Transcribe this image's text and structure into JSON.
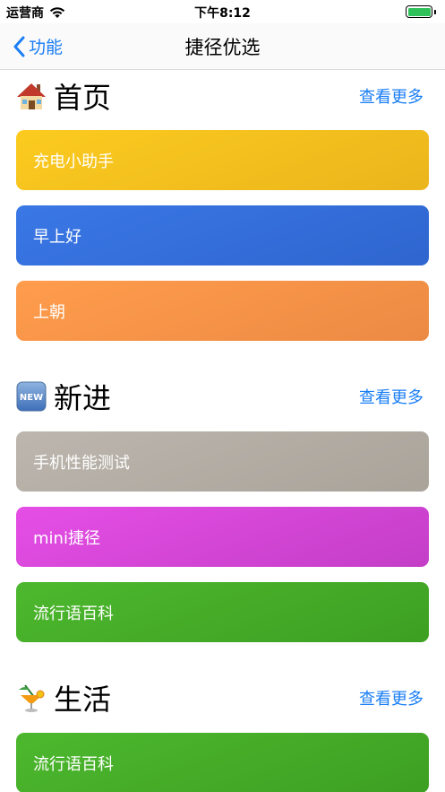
{
  "status_bar": {
    "carrier": "运营商",
    "time": "下午8:12",
    "battery_level": 1.0
  },
  "nav": {
    "back_label": "功能",
    "title": "捷径优选"
  },
  "sections": [
    {
      "title": "首页",
      "icon": "house-emoji-icon",
      "more_label": "查看更多",
      "cards": [
        {
          "label": "充电小助手",
          "color_start": "#fccb1f",
          "color_end": "#eab51c"
        },
        {
          "label": "早上好",
          "color_start": "#3a78e6",
          "color_end": "#2f65cf"
        },
        {
          "label": "上朝",
          "color_start": "#ff9c4c",
          "color_end": "#ec8a44"
        }
      ]
    },
    {
      "title": "新进",
      "icon": "new-badge-icon",
      "more_label": "查看更多",
      "cards": [
        {
          "label": "手机性能测试",
          "color_start": "#bcb6ae",
          "color_end": "#a9a39a"
        },
        {
          "label": "mini捷径",
          "color_start": "#e64ee6",
          "color_end": "#c33ec7"
        },
        {
          "label": "流行语百科",
          "color_start": "#4db82e",
          "color_end": "#3d9f22"
        }
      ]
    },
    {
      "title": "生活",
      "icon": "tropical-drink-icon",
      "more_label": "查看更多",
      "cards": [
        {
          "label": "流行语百科",
          "color_start": "#4db82e",
          "color_end": "#3d9f22"
        }
      ]
    }
  ]
}
